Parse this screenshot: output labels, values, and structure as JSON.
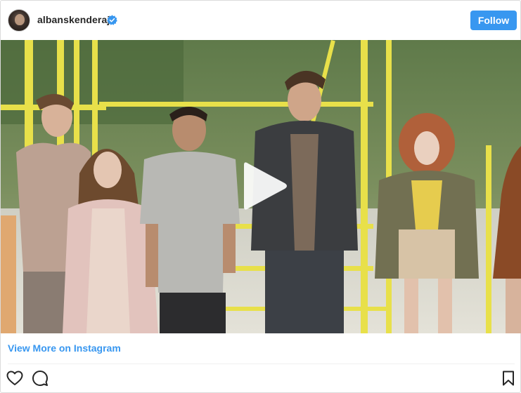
{
  "post": {
    "username": "albanskenderaj",
    "verified": true,
    "follow_label": "Follow",
    "view_more_label": "View More on Instagram"
  },
  "media": {
    "type": "video",
    "play_icon": "play-icon"
  },
  "actions": {
    "like_icon": "heart-icon",
    "comment_icon": "comment-icon",
    "save_icon": "bookmark-icon"
  },
  "colors": {
    "accent": "#3897f0",
    "text": "#262626",
    "border": "#dbdbdb"
  }
}
